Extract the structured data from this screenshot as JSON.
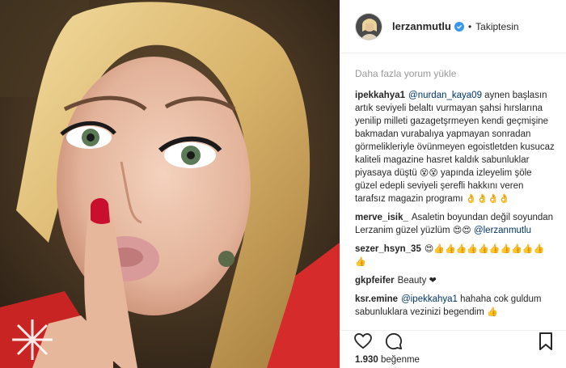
{
  "post": {
    "username": "lerzanmutlu",
    "follow_status": "Takiptesin",
    "load_more": "Daha fazla yorum yükle",
    "likes_count": "1.930",
    "likes_word": "beğenme"
  },
  "comments": [
    {
      "user": "ipekkahya1",
      "parts": [
        {
          "type": "mention",
          "text": "@nurdan_kaya09"
        },
        {
          "type": "text",
          "text": " aynen başlasın artık seviyeli belaltı vurmayan şahsi hırslarına yenilip milleti gazagetşrmeyen kendi geçmişine bakmadan vurabalıya yapmayan sonradan görmelikleriyle övünmeyen egoistletden kusucaz kaliteli magazine hasret kaldık sabunluklar piyasaya düştü "
        },
        {
          "type": "emoji",
          "text": "😵😵"
        },
        {
          "type": "text",
          "text": " yapında izleyelim şöle güzel edepli seviyeli şerefli hakkını veren tarafsız magazin programı "
        },
        {
          "type": "emoji",
          "text": "👌👌👌👌"
        }
      ]
    },
    {
      "user": "merve_isik_",
      "parts": [
        {
          "type": "text",
          "text": "Asaletin boyundan değil soyundan Lerzanim güzel yüzlüm "
        },
        {
          "type": "emoji",
          "text": "😍😍"
        },
        {
          "type": "text",
          "text": " "
        },
        {
          "type": "mention",
          "text": "@lerzanmutlu"
        }
      ]
    },
    {
      "user": "sezer_hsyn_35",
      "parts": [
        {
          "type": "emoji",
          "text": "😍👍👍👍👍👍👍👍👍👍👍👍"
        }
      ]
    },
    {
      "user": "gkpfeifer",
      "parts": [
        {
          "type": "text",
          "text": "Beauty "
        },
        {
          "type": "emoji",
          "text": "❤"
        }
      ]
    },
    {
      "user": "ksr.emine",
      "parts": [
        {
          "type": "mention",
          "text": "@ipekkahya1"
        },
        {
          "type": "text",
          "text": " hahaha cok guldum sabunluklara vezinizi begendim "
        },
        {
          "type": "emoji",
          "text": "👍"
        }
      ]
    }
  ],
  "icons": {
    "verified": "verified-badge-icon",
    "like": "heart-icon",
    "comment": "comment-bubble-icon",
    "save": "bookmark-icon"
  },
  "colors": {
    "accent": "#3897f0",
    "mention": "#003569",
    "muted": "#999999",
    "heart": "#ed4956"
  }
}
